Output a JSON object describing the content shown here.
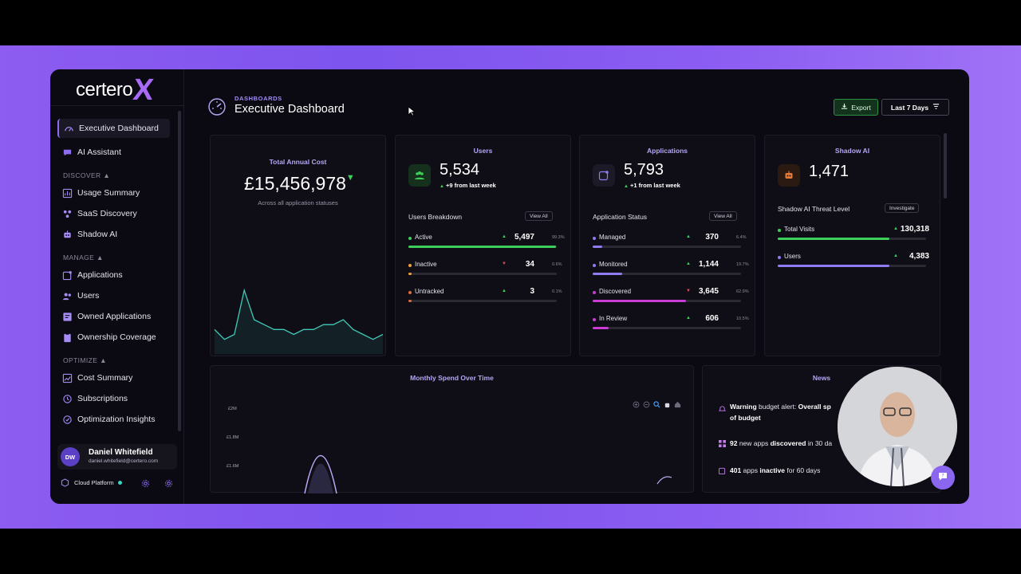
{
  "brand": {
    "name": "certero",
    "x": "X"
  },
  "sidebar": {
    "items": [
      {
        "label": "Executive Dashboard"
      },
      {
        "label": "AI Assistant"
      },
      {
        "label": "Usage Summary"
      },
      {
        "label": "SaaS Discovery"
      },
      {
        "label": "Shadow AI"
      },
      {
        "label": "Applications"
      },
      {
        "label": "Users"
      },
      {
        "label": "Owned Applications"
      },
      {
        "label": "Ownership Coverage"
      },
      {
        "label": "Cost Summary"
      },
      {
        "label": "Subscriptions"
      },
      {
        "label": "Optimization Insights"
      }
    ],
    "sections": {
      "discover": "DISCOVER ▲",
      "manage": "MANAGE ▲",
      "optimize": "OPTIMIZE ▲"
    },
    "user": {
      "initials": "DW",
      "name": "Daniel Whitefield",
      "email": "daniel.whitefield@certero.com"
    },
    "platform": "Cloud Platform"
  },
  "header": {
    "breadcrumb": "DASHBOARDS",
    "title": "Executive Dashboard",
    "export_label": "Export",
    "range_label": "Last 7 Days"
  },
  "cost": {
    "title": "Total Annual Cost",
    "value": "£15,456,978",
    "arrow": "▼",
    "caption": "Across all application statuses",
    "sparkline": [
      4,
      2,
      3,
      12,
      6,
      5,
      4,
      4,
      3,
      4,
      4,
      5,
      5,
      6,
      4,
      3,
      2,
      3
    ]
  },
  "users": {
    "title": "Users",
    "value": "5,534",
    "change_strong": "+9 from last week",
    "breakdown_label": "Users Breakdown",
    "view_all": "View All",
    "rows": [
      {
        "label": "Active",
        "value": "5,497",
        "pct": "99.3%",
        "dir": "▲",
        "color": "#3ccf5a",
        "fraction": 0.993
      },
      {
        "label": "Inactive",
        "value": "34",
        "pct": "0.6%",
        "dir": "▼",
        "color": "#f0a030",
        "fraction": 0.006
      },
      {
        "label": "Untracked",
        "value": "3",
        "pct": "0.1%",
        "dir": "▲",
        "color": "#e06a3a",
        "fraction": 0.001
      }
    ]
  },
  "applications": {
    "title": "Applications",
    "value": "5,793",
    "change_strong": "+1 from last week",
    "status_label": "Application Status",
    "view_all": "View All",
    "rows": [
      {
        "label": "Managed",
        "value": "370",
        "pct": "6.4%",
        "dir": "▲",
        "color": "#8d7cf2",
        "fraction": 0.064
      },
      {
        "label": "Monitored",
        "value": "1,144",
        "pct": "19.7%",
        "dir": "▲",
        "color": "#8d7cf2",
        "fraction": 0.197
      },
      {
        "label": "Discovered",
        "value": "3,645",
        "pct": "62.9%",
        "dir": "▼",
        "color": "#c93cd6",
        "fraction": 0.629
      },
      {
        "label": "In Review",
        "value": "606",
        "pct": "10.5%",
        "dir": "▲",
        "color": "#c93cd6",
        "fraction": 0.105
      }
    ]
  },
  "shadow_ai": {
    "title": "Shadow AI",
    "value": "1,471",
    "threat_label": "Shadow AI Threat Level",
    "investigate": "Investigate",
    "rows": [
      {
        "label": "Total Visits",
        "value": "130,318",
        "dir": "▲",
        "color": "#3ccf5a",
        "fraction": 0.75
      },
      {
        "label": "Users",
        "value": "4,383",
        "dir": "▲",
        "color": "#8d7cf2",
        "fraction": 0.75
      }
    ]
  },
  "spend": {
    "title": "Monthly Spend Over Time",
    "y_ticks": [
      "£2M",
      "£1.8M",
      "£1.6M"
    ]
  },
  "news": {
    "title": "News",
    "items": [
      {
        "strong": "Warning",
        "text": " budget alert: ",
        "strong2": "Overall sp",
        "line2": "of budget"
      },
      {
        "strong": "92",
        "text": " new apps ",
        "strong2": "discovered",
        "tail": " in 30 da"
      },
      {
        "strong": "401",
        "text": " apps ",
        "strong2": "inactive",
        "tail": " for 60 days"
      }
    ]
  },
  "colors": {
    "accent": "#8d6cf3",
    "green": "#3ccf5a",
    "pink": "#c93cd6",
    "background": "#0b0a12"
  }
}
